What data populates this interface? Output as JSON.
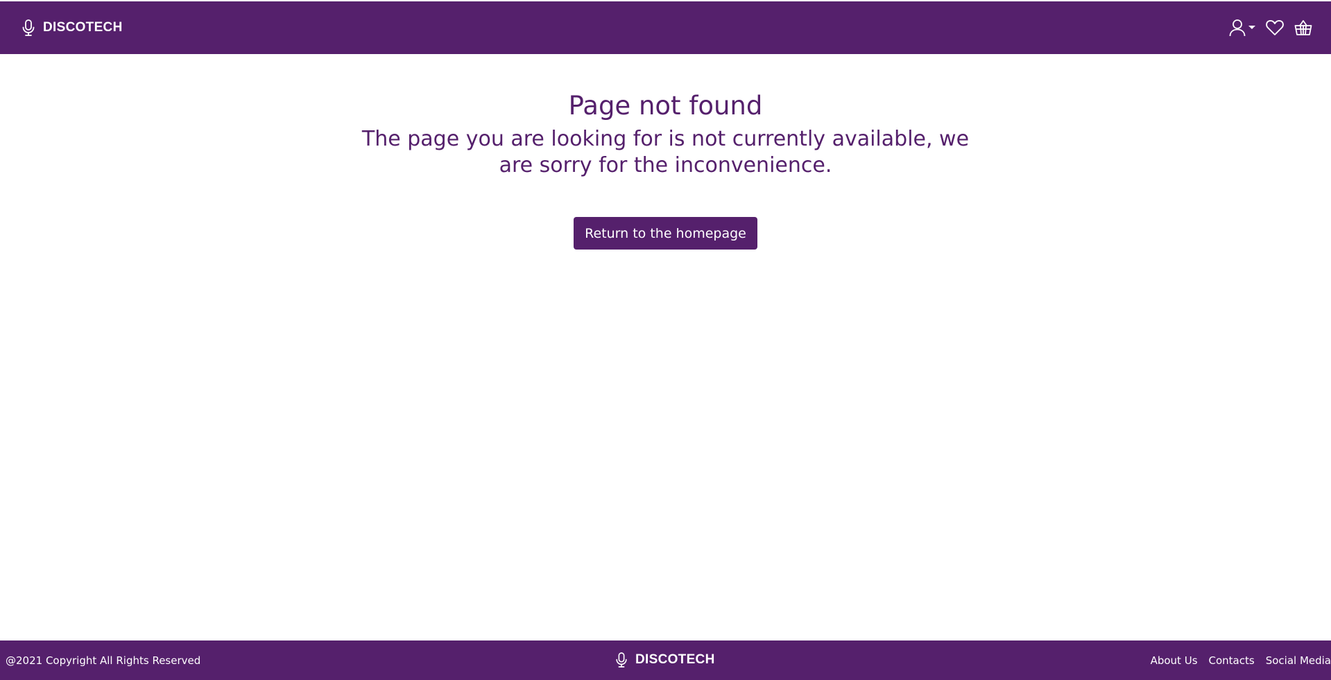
{
  "header": {
    "brand_name": "DISCOTECH",
    "brand_icon": "microphone-icon",
    "icons": [
      "user-icon",
      "caret-down-icon",
      "heart-icon",
      "basket-icon"
    ]
  },
  "main": {
    "title": "Page not found",
    "subtitle": "The page you are looking for is not currently available, we are sorry for the inconvenience.",
    "button_label": "Return to the homepage"
  },
  "footer": {
    "copyright": "@2021 Copyright All Rights Reserved",
    "brand_name": "DISCOTECH",
    "links": [
      "About Us",
      "Contacts",
      "Social Media"
    ]
  },
  "colors": {
    "brand_purple": "#55206c",
    "text_on_brand": "#ffffff",
    "background": "#ffffff"
  }
}
